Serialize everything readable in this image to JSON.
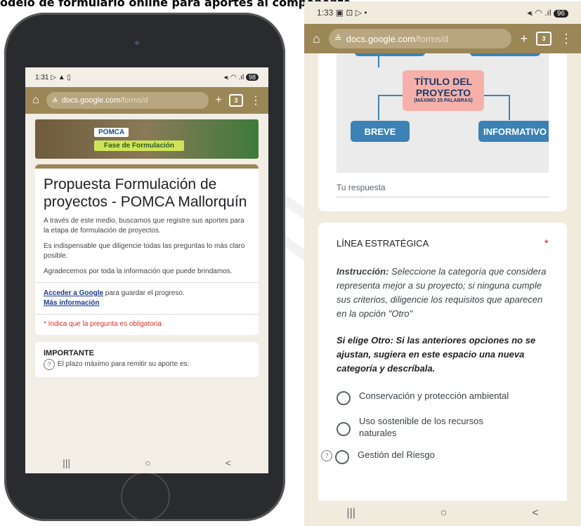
{
  "caption": "odelo de formulario online para aportes al componente",
  "left_phone": {
    "status": {
      "time": "1:31",
      "left_icons": "▷ ▲ ▯",
      "right_icons": "◂ᵢ ◠ .ıl",
      "battery": "98"
    },
    "chrome": {
      "url_main": "docs.google.com",
      "url_dim": "/forms/d",
      "tabs_count": "3",
      "plus": "+",
      "menu": "⋮",
      "home": "⌂"
    },
    "banner": {
      "brand": "POMCA",
      "phase": "Fase de Formulación"
    },
    "form": {
      "title": "Propuesta Formulación de proyectos - POMCA Mallorquín",
      "desc1": "A través de este medio, buscamos que registre sus aportes para la etapa de formulación de proyectos.",
      "desc2": "Es indispensable que diligencie todas las preguntas lo más claro posible.",
      "desc3": "Agradecemos por toda la información que puede brindamos.",
      "google_link": "Acceder a Google",
      "google_rest": " para guardar el progreso.",
      "more_info": "Más información",
      "required_note": "* Indica que la pregunta es obligatoria",
      "important_title": "IMPORTANTE",
      "important_text": "El plazo máximo para remitir su aporte es:"
    },
    "nav": {
      "recents": "|||",
      "home": "○",
      "back": "<"
    }
  },
  "right_phone": {
    "status": {
      "time": "1:33",
      "left_icons": "▣ ⊡ ▷ •",
      "right_icons": "◂ᵢ ◠ .ıl",
      "battery": "96"
    },
    "chrome": {
      "url_main": "docs.google.com",
      "url_dim": "/forms/d",
      "tabs_count": "3",
      "plus": "+",
      "menu": "⋮",
      "home": "⌂"
    },
    "mindmap": {
      "title": "TÍTULO DEL PROYECTO",
      "subtitle": "(MÁXIMO 25 PALABRAS)",
      "box_left": "BREVE",
      "box_right": "INFORMATIVO"
    },
    "answer_placeholder": "Tu respuesta",
    "question": {
      "title": "LÍNEA ESTRATÉGICA",
      "required": "*",
      "instruction_label": "Instrucción:",
      "instruction_text": " Seleccione la categoría que considera representa mejor a su proyecto; si ninguna cumple sus criterios, diligencie los requisitos que aparecen en la opción \"Otro\"",
      "other_note": "Si elige Otro: Si las anteriores opciones no se ajustan, sugiera en este espacio una nueva categoría y descríbala.",
      "options": [
        "Conservación y protección ambiental",
        "Uso sostenible de los recursos naturales",
        "Gestión del Riesgo"
      ]
    },
    "help": "?",
    "nav": {
      "recents": "|||",
      "home": "○",
      "back": "<"
    }
  }
}
